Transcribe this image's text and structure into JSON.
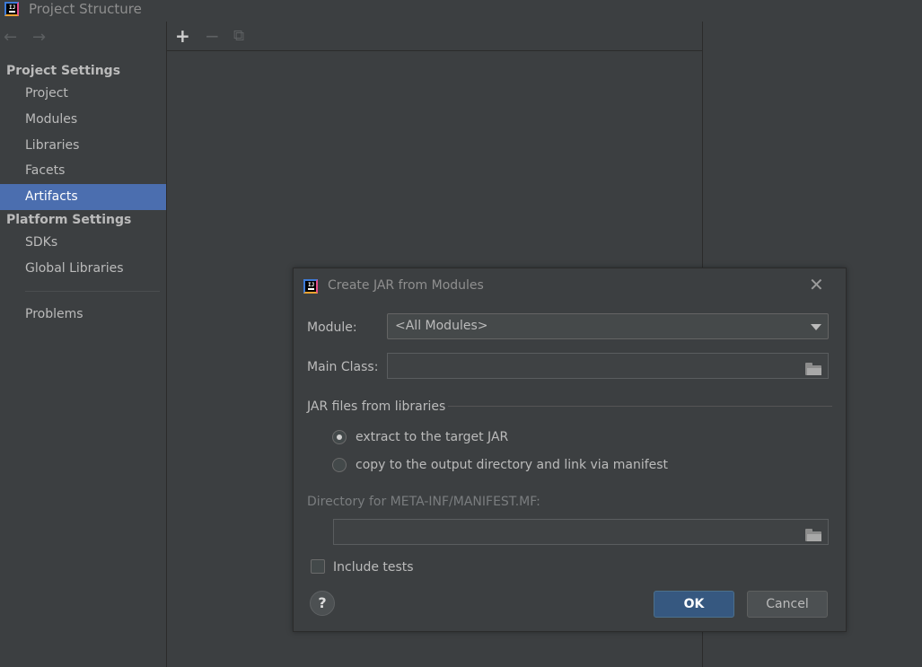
{
  "window": {
    "title": "Project Structure"
  },
  "sidebar": {
    "project_settings_heading": "Project Settings",
    "project_items": [
      {
        "label": "Project"
      },
      {
        "label": "Modules"
      },
      {
        "label": "Libraries"
      },
      {
        "label": "Facets"
      },
      {
        "label": "Artifacts",
        "selected": true
      }
    ],
    "platform_settings_heading": "Platform Settings",
    "platform_items": [
      {
        "label": "SDKs"
      },
      {
        "label": "Global Libraries"
      }
    ],
    "problems_label": "Problems"
  },
  "toolbar": {
    "add_glyph": "+",
    "remove_glyph": "−",
    "copy_glyph": "⧉"
  },
  "dialog": {
    "title": "Create JAR from Modules",
    "module_label": "Module:",
    "module_value": "<All Modules>",
    "main_class_label": "Main Class:",
    "main_class_value": "",
    "jar_group_label": "JAR files from libraries",
    "radio_extract": {
      "label": "extract to the target JAR",
      "checked": true
    },
    "radio_copy": {
      "label": "copy to the output directory and link via manifest",
      "checked": false
    },
    "manifest_dir_label": "Directory for META-INF/MANIFEST.MF:",
    "manifest_dir_value": "",
    "include_tests_label": "Include tests",
    "include_tests_checked": false,
    "help_glyph": "?",
    "ok_label": "OK",
    "cancel_label": "Cancel",
    "close_glyph": "✕"
  },
  "colors": {
    "background": "#3c3f41",
    "selection": "#4b6eaf",
    "ok_button": "#365880",
    "text": "#bbbbbb"
  },
  "icons": [
    "intellij-logo-icon",
    "back-arrow-icon",
    "forward-arrow-icon",
    "add-icon",
    "remove-icon",
    "copy-icon",
    "close-icon",
    "dropdown-arrow-icon",
    "folder-icon",
    "help-icon"
  ]
}
